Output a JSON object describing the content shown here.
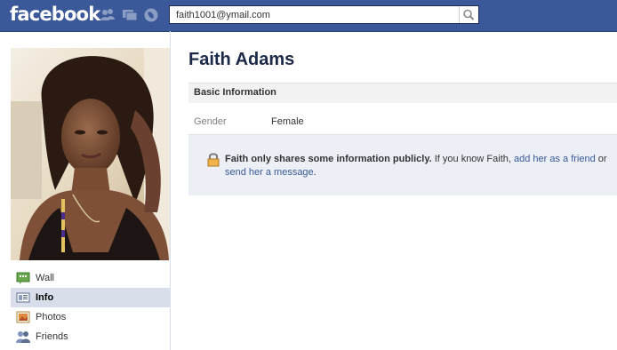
{
  "topbar": {
    "logo": "facebook",
    "search": {
      "value": "faith1001@ymail.com",
      "placeholder": ""
    },
    "colors": {
      "bar": "#3b5998",
      "link": "#3b5998"
    },
    "icons": [
      "friend-requests-icon",
      "messages-icon",
      "notifications-icon",
      "search-icon"
    ]
  },
  "sidebar": {
    "items": [
      {
        "label": "Wall",
        "icon": "wall-icon",
        "active": false
      },
      {
        "label": "Info",
        "icon": "info-icon",
        "active": true
      },
      {
        "label": "Photos",
        "icon": "photos-icon",
        "active": false
      },
      {
        "label": "Friends",
        "icon": "friends-icon",
        "active": false
      }
    ]
  },
  "profile": {
    "name": "Faith Adams",
    "section_title": "Basic Information",
    "fields": [
      {
        "label": "Gender",
        "value": "Female"
      }
    ],
    "privacy": {
      "bold": "Faith only shares some information publicly.",
      "text1": " If you know Faith, ",
      "link1": "add her as a friend",
      "text2": " or ",
      "link2": "send her a message",
      "text3": "."
    }
  }
}
